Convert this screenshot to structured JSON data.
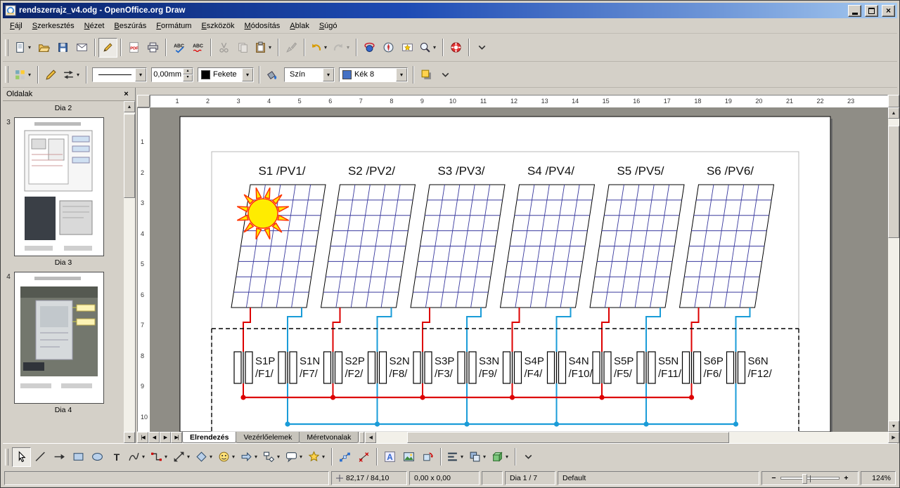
{
  "window": {
    "title": "rendszerrajz_v4.odg - OpenOffice.org Draw"
  },
  "menubar": [
    "Fájl",
    "Szerkesztés",
    "Nézet",
    "Beszúrás",
    "Formátum",
    "Eszközök",
    "Módosítás",
    "Ablak",
    "Súgó"
  ],
  "glyphs": {
    "dropdown": "▾",
    "spin_up": "▴",
    "spin_down": "▾",
    "scroll_up": "▲",
    "scroll_down": "▼",
    "scroll_left": "◀",
    "scroll_right": "▶",
    "close": "×",
    "zoom_out": "−",
    "zoom_in": "+"
  },
  "toolbar_standard": [
    {
      "icon": "new",
      "name": "new-document-button",
      "dropdown": true
    },
    {
      "icon": "open",
      "name": "open-document-button"
    },
    {
      "icon": "save",
      "name": "save-document-button"
    },
    {
      "icon": "email",
      "name": "document-as-email-button"
    },
    {
      "sep": true
    },
    {
      "icon": "edit",
      "name": "edit-file-button",
      "pressed": true
    },
    {
      "sep": true
    },
    {
      "icon": "pdf",
      "name": "export-as-pdf-button"
    },
    {
      "icon": "print",
      "name": "print-button"
    },
    {
      "sep": true
    },
    {
      "icon": "spellcheck",
      "name": "spellcheck-button"
    },
    {
      "icon": "autospell",
      "name": "auto-spellcheck-button"
    },
    {
      "sep": true
    },
    {
      "icon": "cut",
      "name": "cut-button",
      "disabled": true
    },
    {
      "icon": "copy",
      "name": "copy-button",
      "disabled": true
    },
    {
      "icon": "paste",
      "name": "paste-button",
      "dropdown": true
    },
    {
      "sep": true
    },
    {
      "icon": "brush",
      "name": "format-paintbrush-button",
      "disabled": true
    },
    {
      "sep": true
    },
    {
      "icon": "undo",
      "name": "undo-button",
      "dropdown": true
    },
    {
      "icon": "redo",
      "name": "redo-button",
      "dropdown": true,
      "disabled": true
    },
    {
      "sep": true
    },
    {
      "icon": "hyperlink",
      "name": "hyperlink-button"
    },
    {
      "icon": "navigator",
      "name": "navigator-button"
    },
    {
      "icon": "gallery",
      "name": "gallery-button"
    },
    {
      "icon": "zoom",
      "name": "zoom-button",
      "dropdown": true
    },
    {
      "sep": true
    },
    {
      "icon": "help",
      "name": "help-button"
    },
    {
      "sep": true
    },
    {
      "icon": "more",
      "name": "toolbar-options-button"
    }
  ],
  "toolbar_line": {
    "buttons_left": [
      {
        "icon": "styles",
        "name": "styles-and-formatting-button",
        "dropdown": true
      },
      {
        "sep": true
      },
      {
        "icon": "pen",
        "name": "line-dialog-button"
      },
      {
        "icon": "arrowstyles",
        "name": "arrow-styles-button",
        "dropdown": true
      },
      {
        "sep": true
      }
    ],
    "line_width": "0,00mm",
    "line_color": "Fekete",
    "line_color_hex": "#000000",
    "fill_style": "Szín",
    "fill_color": "Kék 8",
    "fill_color_hex": "#4571c4",
    "buttons_mid": [
      {
        "icon": "bucket",
        "name": "area-dialog-button"
      }
    ],
    "buttons_right": [
      {
        "sep": true
      },
      {
        "icon": "shadow",
        "name": "shadow-toggle-button"
      },
      {
        "icon": "more",
        "name": "line-toolbar-options-button"
      }
    ]
  },
  "pages_panel": {
    "title": "Oldalak",
    "pages": [
      {
        "label": "Dia 2"
      },
      {
        "num": "3",
        "label": "Dia 3",
        "thumb": "diagram"
      },
      {
        "num": "4",
        "label": "Dia 4",
        "thumb": "photo"
      }
    ]
  },
  "rulers": {
    "horizontal": [
      "1",
      "2",
      "3",
      "4",
      "5",
      "6",
      "7",
      "8",
      "9",
      "10",
      "11",
      "12",
      "13",
      "14",
      "15",
      "16",
      "17",
      "18",
      "19",
      "20",
      "21",
      "22",
      "23"
    ],
    "vertical": [
      "1",
      "2",
      "3",
      "4",
      "5",
      "6",
      "7",
      "8",
      "9",
      "10"
    ]
  },
  "tabs_nav": [
    {
      "name": "first-slide-button",
      "glyph": "|◀"
    },
    {
      "name": "previous-slide-button",
      "glyph": "◀"
    },
    {
      "name": "next-slide-button",
      "glyph": "▶"
    },
    {
      "name": "last-slide-button",
      "glyph": "▶|"
    }
  ],
  "tabs": [
    {
      "label": "Elrendezés",
      "active": true
    },
    {
      "label": "Vezérlőelemek",
      "active": false
    },
    {
      "label": "Méretvonalak",
      "active": false
    }
  ],
  "diagram": {
    "strings": [
      {
        "title": "S1 /PV1/",
        "p_name": "S1P",
        "p_fuse": "/F1/",
        "n_name": "S1N",
        "n_fuse": "/F7/"
      },
      {
        "title": "S2 /PV2/",
        "p_name": "S2P",
        "p_fuse": "/F2/",
        "n_name": "S2N",
        "n_fuse": "/F8/"
      },
      {
        "title": "S3 /PV3/",
        "p_name": "S3P",
        "p_fuse": "/F3/",
        "n_name": "S3N",
        "n_fuse": "/F9/"
      },
      {
        "title": "S4 /PV4/",
        "p_name": "S4P",
        "p_fuse": "/F4/",
        "n_name": "S4N",
        "n_fuse": "/F10/"
      },
      {
        "title": "S5 /PV5/",
        "p_name": "S5P",
        "p_fuse": "/F5/",
        "n_name": "S5N",
        "n_fuse": "/F11/"
      },
      {
        "title": "S6 /PV6/",
        "p_name": "S6P",
        "p_fuse": "/F6/",
        "n_name": "S6N",
        "n_fuse": "/F12/"
      }
    ],
    "colors": {
      "positive": "#dd0000",
      "negative": "#1a9cd8",
      "panel_grid": "#3a3a9e",
      "sun": "#ffec00",
      "sun_ray_stroke": "#ff3300"
    }
  },
  "drawing_toolbar": [
    {
      "icon": "select",
      "name": "select-tool",
      "pressed": true
    },
    {
      "icon": "line",
      "name": "line-tool"
    },
    {
      "icon": "arrow",
      "name": "arrow-tool"
    },
    {
      "icon": "rect",
      "name": "rectangle-tool"
    },
    {
      "icon": "ellipse",
      "name": "ellipse-tool"
    },
    {
      "icon": "text",
      "name": "text-tool"
    },
    {
      "icon": "curve",
      "name": "curve-tool",
      "dropdown": true
    },
    {
      "icon": "connector",
      "name": "connector-tool",
      "dropdown": true
    },
    {
      "icon": "linesarrows",
      "name": "lines-and-arrows-tool",
      "dropdown": true
    },
    {
      "icon": "basicshapes",
      "name": "basic-shapes-tool",
      "dropdown": true
    },
    {
      "icon": "symbolshapes",
      "name": "symbol-shapes-tool",
      "dropdown": true
    },
    {
      "icon": "blockarrows",
      "name": "block-arrows-tool",
      "dropdown": true
    },
    {
      "icon": "flowchart",
      "name": "flowchart-shapes-tool",
      "dropdown": true
    },
    {
      "icon": "callouts",
      "name": "callout-shapes-tool",
      "dropdown": true
    },
    {
      "icon": "stars",
      "name": "star-shapes-tool",
      "dropdown": true
    },
    {
      "sep": true
    },
    {
      "icon": "points",
      "name": "edit-points-button"
    },
    {
      "icon": "gluepoints",
      "name": "glue-points-button"
    },
    {
      "sep": true
    },
    {
      "icon": "fontwork",
      "name": "fontwork-gallery-button"
    },
    {
      "icon": "fromfile",
      "name": "insert-picture-button"
    },
    {
      "icon": "rotate",
      "name": "rotate-tool"
    },
    {
      "sep": true
    },
    {
      "icon": "align",
      "name": "alignment-button",
      "dropdown": true
    },
    {
      "icon": "arrange",
      "name": "arrange-button",
      "dropdown": true
    },
    {
      "icon": "extrusion",
      "name": "extrusion-toggle-button",
      "dropdown": true
    },
    {
      "sep": true
    },
    {
      "icon": "more",
      "name": "drawing-toolbar-options-button"
    }
  ],
  "status_bar": {
    "position": "82,17 / 84,10",
    "size": "0,00 x 0,00",
    "slide": "Dia 1 / 7",
    "style": "Default",
    "zoom": "124%"
  }
}
